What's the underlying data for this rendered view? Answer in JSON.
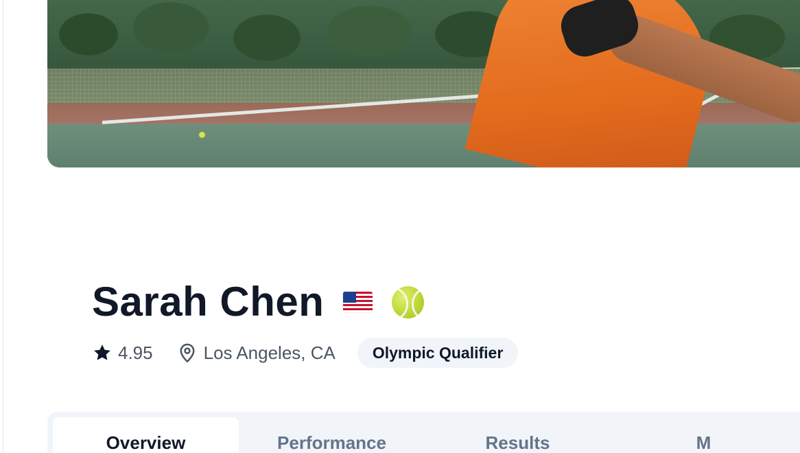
{
  "cover": {
    "image_alt": "tennis-player-cover-photo"
  },
  "profile": {
    "name": "Sarah Chen",
    "country_flag": "us-flag-icon",
    "sport_icon": "tennis-ball-icon",
    "rating": "4.95",
    "location": "Los Angeles, CA",
    "badge": "Olympic Qualifier"
  },
  "tabs": [
    {
      "label": "Overview",
      "active": true
    },
    {
      "label": "Performance",
      "active": false
    },
    {
      "label": "Results",
      "active": false
    },
    {
      "label": "M",
      "active": false
    }
  ],
  "colors": {
    "name_text": "#111827",
    "muted_text": "#4b5563",
    "badge_bg": "#f1f5f9",
    "tabs_bg": "#f1f5f9",
    "tab_inactive_text": "#64748b"
  }
}
